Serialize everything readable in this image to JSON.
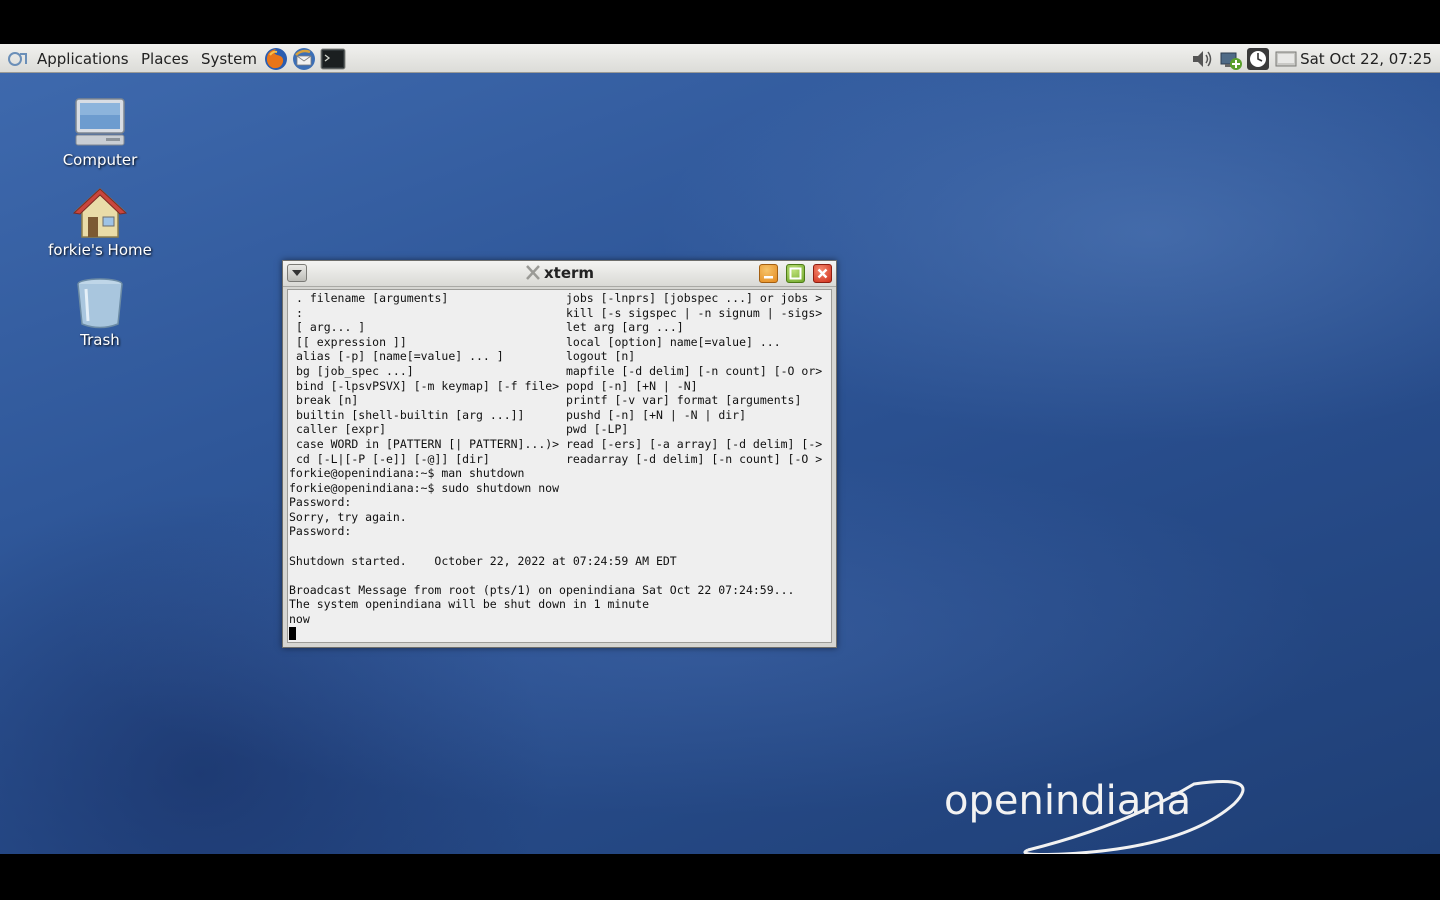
{
  "top_panel": {
    "menus": [
      "Applications",
      "Places",
      "System"
    ],
    "clock": "Sat Oct 22, 07:25"
  },
  "desktop": {
    "icons": [
      {
        "label": "Computer"
      },
      {
        "label": "forkie's Home"
      },
      {
        "label": "Trash"
      }
    ],
    "logo_text": "openindiana"
  },
  "xterm": {
    "title": "xterm",
    "help_left": [
      ". filename [arguments]",
      ":",
      "[ arg... ]",
      "[[ expression ]]",
      "alias [-p] [name[=value] ... ]",
      "bg [job_spec ...]",
      "bind [-lpsvPSVX] [-m keymap] [-f file>",
      "break [n]",
      "builtin [shell-builtin [arg ...]]",
      "caller [expr]",
      "case WORD in [PATTERN [| PATTERN]...)>",
      "cd [-L|[-P [-e]] [-@]] [dir]"
    ],
    "help_right": [
      "jobs [-lnprs] [jobspec ...] or jobs >",
      "kill [-s sigspec | -n signum | -sigs>",
      "let arg [arg ...]",
      "local [option] name[=value] ...",
      "logout [n]",
      "mapfile [-d delim] [-n count] [-O or>",
      "popd [-n] [+N | -N]",
      "printf [-v var] format [arguments]",
      "pushd [-n] [+N | -N | dir]",
      "pwd [-LP]",
      "read [-ers] [-a array] [-d delim] [->",
      "readarray [-d delim] [-n count] [-O >"
    ],
    "output": [
      "forkie@openindiana:~$ man shutdown",
      "forkie@openindiana:~$ sudo shutdown now",
      "Password:",
      "Sorry, try again.",
      "Password:",
      "",
      "Shutdown started.    October 22, 2022 at 07:24:59 AM EDT",
      "",
      "Broadcast Message from root (pts/1) on openindiana Sat Oct 22 07:24:59...",
      "The system openindiana will be shut down in 1 minute",
      "now"
    ]
  },
  "colors": {
    "panel": "#e6e6e2",
    "desktop": "#2f5799",
    "terminal_bg": "#efefef",
    "close_button": "#d9432c",
    "minimize_button": "#e8a035",
    "maximize_button": "#8fc33a"
  }
}
